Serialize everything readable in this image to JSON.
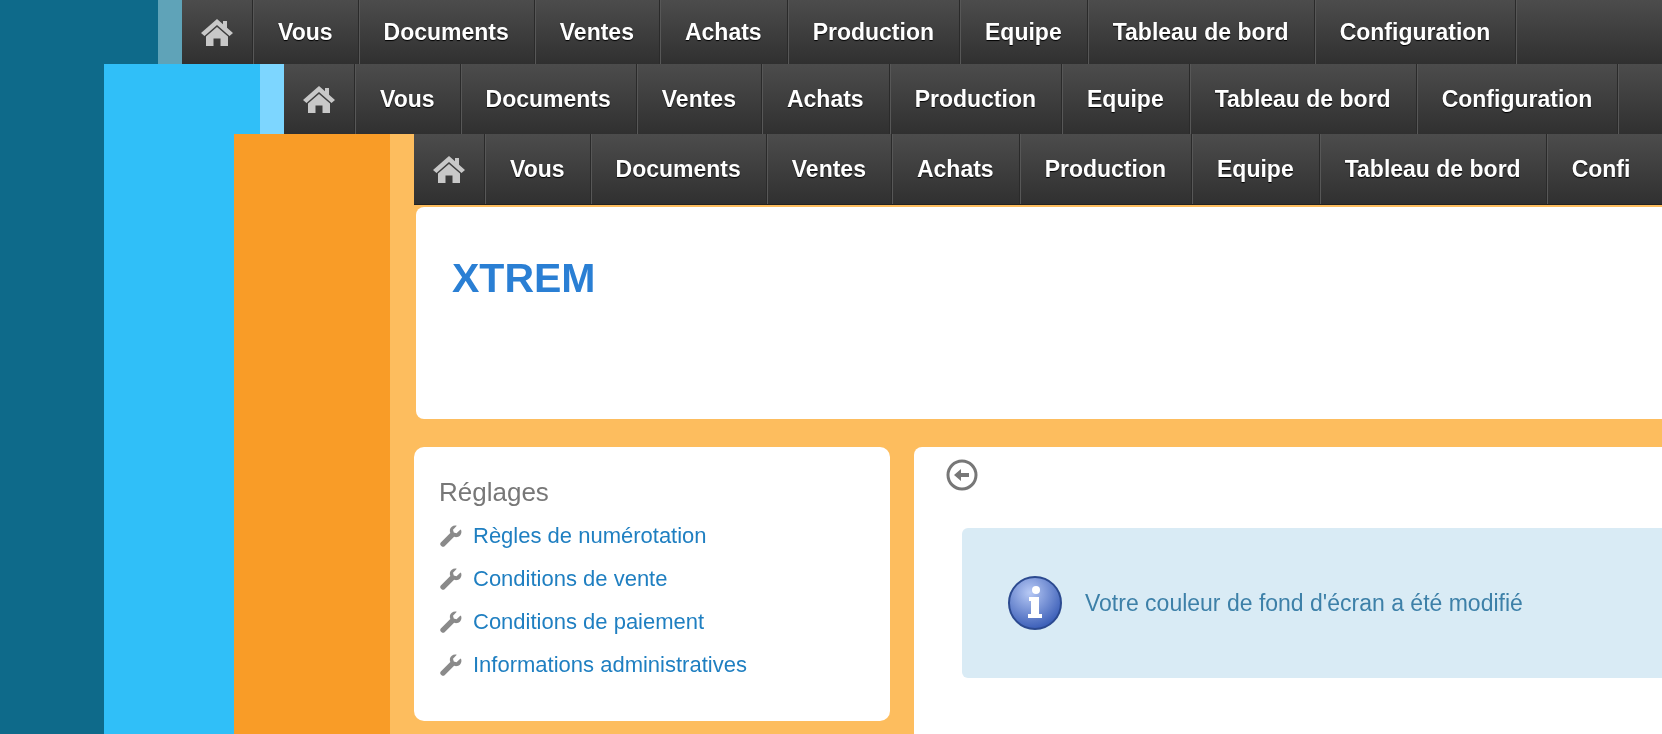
{
  "layers": [
    {
      "color": "#0e6a8a",
      "strip": {
        "color": "#5fa3b8"
      },
      "menu": [
        "Vous",
        "Documents",
        "Ventes",
        "Achats",
        "Production",
        "Equipe",
        "Tableau de bord",
        "Configuration"
      ]
    },
    {
      "color": "#30bff8",
      "strip": {
        "color": "#7dd6ff"
      },
      "menu": [
        "Vous",
        "Documents",
        "Ventes",
        "Achats",
        "Production",
        "Equipe",
        "Tableau de bord",
        "Configuration"
      ]
    },
    {
      "color": "#f99c27",
      "strip": {
        "color": "#fdbd5e"
      },
      "menu": [
        "Vous",
        "Documents",
        "Ventes",
        "Achats",
        "Production",
        "Equipe",
        "Tableau de bord",
        "Confi"
      ],
      "page": {
        "title": "XTREM",
        "settings": {
          "title": "Réglages",
          "links": [
            "Règles de numérotation",
            "Conditions de vente",
            "Conditions de paiement",
            "Informations administratives"
          ]
        },
        "message": "Votre couleur de fond d'écran a été modifié"
      }
    }
  ]
}
